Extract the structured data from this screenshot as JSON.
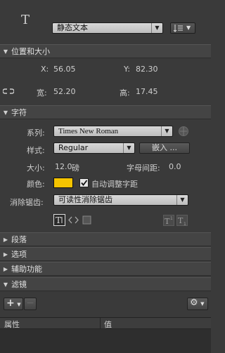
{
  "text_tool": {
    "icon": "T",
    "type_value": "静态文本",
    "orientation_icon": "text-orientation-icon"
  },
  "position_size": {
    "header": "位置和大小",
    "x_label": "X:",
    "x_value": "56.05",
    "y_label": "Y:",
    "y_value": "82.30",
    "w_label": "宽:",
    "w_value": "52.20",
    "h_label": "高:",
    "h_value": "17.45"
  },
  "character": {
    "header": "字符",
    "family_label": "系列:",
    "family_value": "Times New Roman",
    "style_label": "样式:",
    "style_value": "Regular",
    "embed_button": "嵌入 ...",
    "size_label": "大小:",
    "size_value": "12.0",
    "size_unit": "磅",
    "spacing_label": "字母间距:",
    "spacing_value": "0.0",
    "color_label": "颜色:",
    "color_value": "#f5c400",
    "auto_kern_label": "自动调整字距",
    "auto_kern_checked": true,
    "aa_label": "消除锯齿:",
    "aa_value": "可读性消除锯齿"
  },
  "collapsed_sections": [
    "段落",
    "选项",
    "辅助功能",
    "滤镜"
  ],
  "filter_table": {
    "col_property": "属性",
    "col_value": "值"
  }
}
